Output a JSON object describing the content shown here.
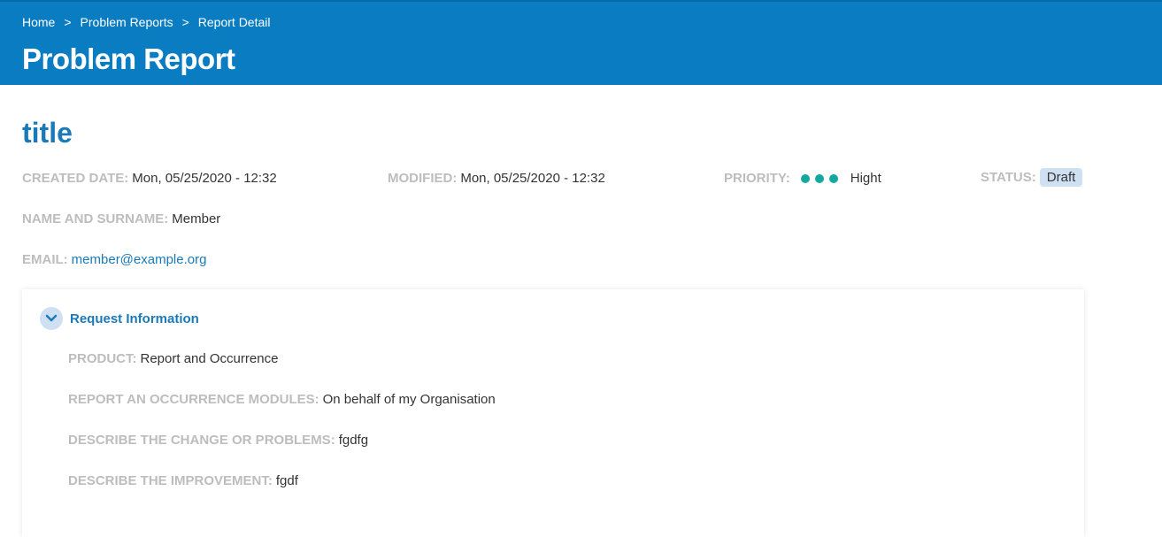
{
  "breadcrumb": {
    "home": "Home",
    "problem_reports": "Problem Reports",
    "current": "Report Detail",
    "separator": ">"
  },
  "header": {
    "title": "Problem Report",
    "background": "#0a7dc2"
  },
  "report": {
    "title": "title",
    "created_date": {
      "label": "CREATED DATE:",
      "value": "Mon, 05/25/2020 - 12:32"
    },
    "modified": {
      "label": "MODIFIED:",
      "value": "Mon, 05/25/2020 - 12:32"
    },
    "priority": {
      "label": "PRIORITY:",
      "value": "Hight",
      "level": 3,
      "dot_color": "#13a89e"
    },
    "status": {
      "label": "STATUS:",
      "value": "Draft"
    },
    "name": {
      "label": "NAME AND SURNAME:",
      "value": "Member"
    },
    "email": {
      "label": "EMAIL:",
      "value": "member@example.org"
    }
  },
  "request_info": {
    "title": "Request Information",
    "expanded": true,
    "product": {
      "label": "PRODUCT:",
      "value": "Report and Occurrence"
    },
    "modules": {
      "label": "REPORT AN OCCURRENCE MODULES:",
      "value": "On behalf of my Organisation"
    },
    "change": {
      "label": "DESCRIBE THE CHANGE OR PROBLEMS:",
      "value": "fgdfg"
    },
    "improvement": {
      "label": "DESCRIBE THE IMPROVEMENT:",
      "value": "fgdf"
    }
  }
}
